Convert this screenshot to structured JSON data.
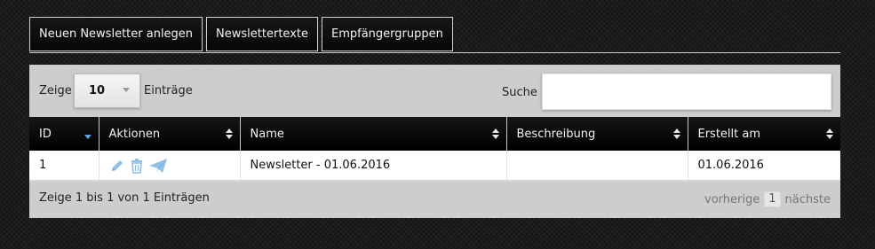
{
  "toolbar": {
    "new_newsletter": "Neuen Newsletter anlegen",
    "newsletter_texts": "Newslettertexte",
    "recipient_groups": "Empfängergruppen"
  },
  "controls": {
    "show_label": "Zeige",
    "page_length": "10",
    "entries_label": "Einträge",
    "search_label": "Suche",
    "search_value": ""
  },
  "table": {
    "columns": [
      "ID",
      "Aktionen",
      "Name",
      "Beschreibung",
      "Erstellt am"
    ],
    "sorted_column": "ID",
    "sort_direction": "desc",
    "rows": [
      {
        "id": "1",
        "actions": [
          "edit-icon",
          "trash-icon",
          "send-icon"
        ],
        "name": "Newsletter - 01.06.2016",
        "description": "",
        "created": "01.06.2016"
      }
    ]
  },
  "footer": {
    "info": "Zeige 1 bis 1 von 1 Einträgen",
    "previous": "vorherige",
    "current_page": "1",
    "next": "nächste"
  },
  "colors": {
    "icon_blue": "#8ec0ea",
    "sort_active": "#5aa6e6",
    "panel": "#cdcdcd"
  }
}
